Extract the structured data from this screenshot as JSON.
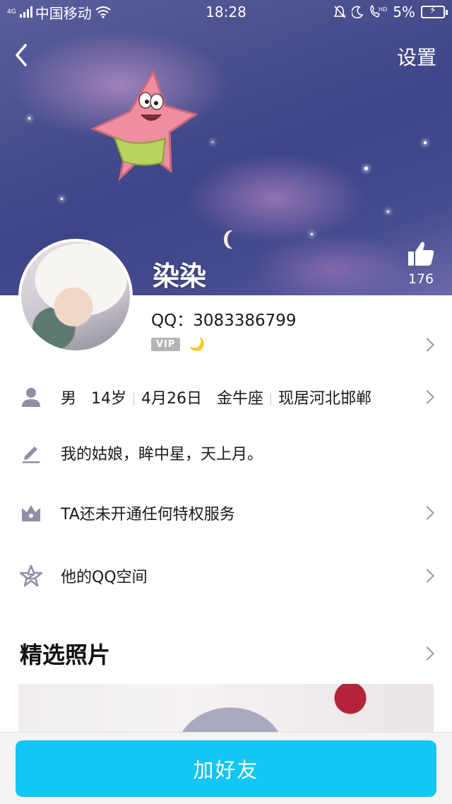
{
  "status_bar": {
    "network_type": "4G",
    "carrier": "中国移动",
    "time": "18:28",
    "battery": "5%"
  },
  "header": {
    "settings_label": "设置"
  },
  "profile": {
    "nickname": "染染",
    "like_count": "176",
    "qq_label": "QQ：",
    "qq_number": "3083386799",
    "vip_badge": "VIP",
    "moon_badge": "🌙"
  },
  "info_rows": {
    "basic": {
      "gender": "男",
      "age": "14岁",
      "birthday": "4月26日",
      "zodiac": "金牛座",
      "location": "现居河北邯郸"
    },
    "signature": "我的姑娘，眸中星，天上月。",
    "privilege": "TA还未开通任何特权服务",
    "qzone": "他的QQ空间"
  },
  "featured_photos": {
    "title": "精选照片"
  },
  "actions": {
    "add_friend_label": "加好友"
  },
  "colors": {
    "accent": "#12c6f5",
    "icon_gray": "#8e90a6",
    "chevron": "#9a9a9a",
    "vip_gray": "#b5b5b5"
  }
}
